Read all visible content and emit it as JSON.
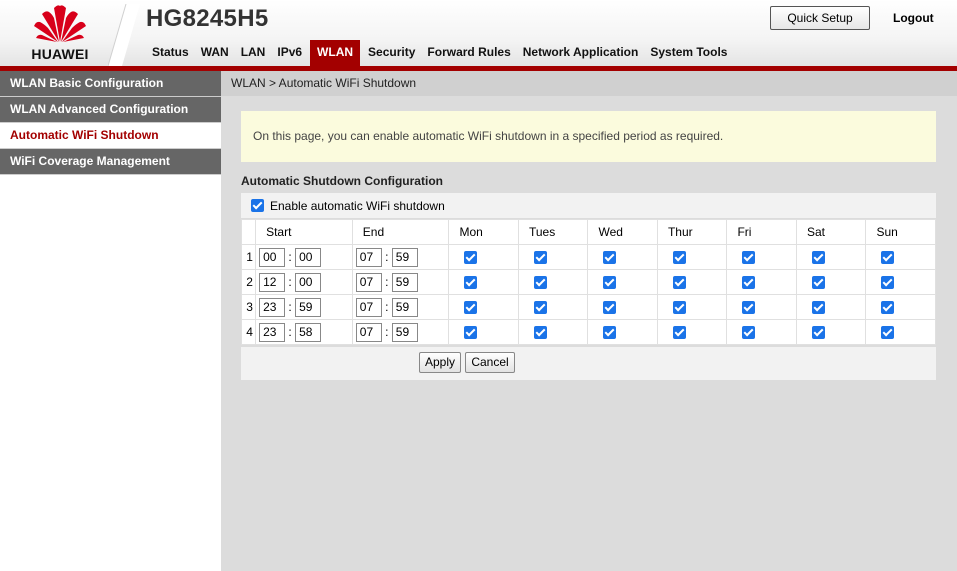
{
  "header": {
    "brand": "HUAWEI",
    "model": "HG8245H5",
    "quick_setup": "Quick Setup",
    "logout": "Logout",
    "brand_color": "#a30000"
  },
  "nav": [
    "Status",
    "WAN",
    "LAN",
    "IPv6",
    "WLAN",
    "Security",
    "Forward Rules",
    "Network Application",
    "System Tools"
  ],
  "nav_active": "WLAN",
  "sidebar": [
    {
      "label": "WLAN Basic Configuration",
      "active": false
    },
    {
      "label": "WLAN Advanced Configuration",
      "active": false
    },
    {
      "label": "Automatic WiFi Shutdown",
      "active": true
    },
    {
      "label": "WiFi Coverage Management",
      "active": false
    }
  ],
  "breadcrumb": "WLAN > Automatic WiFi Shutdown",
  "info": "On this page, you can enable automatic WiFi shutdown in a specified period as required.",
  "section_title": "Automatic Shutdown Configuration",
  "enable": {
    "label": "Enable automatic WiFi shutdown",
    "checked": true
  },
  "table": {
    "headers": [
      "Start",
      "End",
      "Mon",
      "Tues",
      "Wed",
      "Thur",
      "Fri",
      "Sat",
      "Sun"
    ],
    "rows": [
      {
        "index": "1",
        "start": [
          "00",
          "00"
        ],
        "end": [
          "07",
          "59"
        ],
        "days": [
          true,
          true,
          true,
          true,
          true,
          true,
          true
        ]
      },
      {
        "index": "2",
        "start": [
          "12",
          "00"
        ],
        "end": [
          "07",
          "59"
        ],
        "days": [
          true,
          true,
          true,
          true,
          true,
          true,
          true
        ]
      },
      {
        "index": "3",
        "start": [
          "23",
          "59"
        ],
        "end": [
          "07",
          "59"
        ],
        "days": [
          true,
          true,
          true,
          true,
          true,
          true,
          true
        ]
      },
      {
        "index": "4",
        "start": [
          "23",
          "58"
        ],
        "end": [
          "07",
          "59"
        ],
        "days": [
          true,
          true,
          true,
          true,
          true,
          true,
          true
        ]
      }
    ],
    "time_separator": ":"
  },
  "buttons": {
    "apply": "Apply",
    "cancel": "Cancel"
  }
}
